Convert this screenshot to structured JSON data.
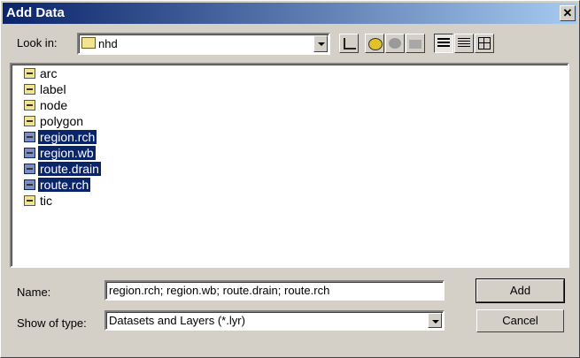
{
  "window": {
    "title": "Add Data",
    "close_label": "✕"
  },
  "lookin": {
    "label": "Look in:",
    "value": "nhd",
    "icon": "folder-icon"
  },
  "toolbar": [
    "up-one-level",
    "connect-to-folder",
    "disconnect-from-folder",
    "new-folder",
    "list-view",
    "details-view",
    "thumbnails-view"
  ],
  "files": [
    {
      "name": "arc",
      "selected": false,
      "icon": "coverage-arc-icon"
    },
    {
      "name": "label",
      "selected": false,
      "icon": "coverage-label-icon"
    },
    {
      "name": "node",
      "selected": false,
      "icon": "coverage-node-icon"
    },
    {
      "name": "polygon",
      "selected": false,
      "icon": "coverage-polygon-icon"
    },
    {
      "name": "region.rch",
      "selected": true,
      "icon": "coverage-region-icon"
    },
    {
      "name": "region.wb",
      "selected": true,
      "icon": "coverage-region-icon"
    },
    {
      "name": "route.drain",
      "selected": true,
      "icon": "coverage-route-icon"
    },
    {
      "name": "route.rch",
      "selected": true,
      "icon": "coverage-route-icon"
    },
    {
      "name": "tic",
      "selected": false,
      "icon": "coverage-tic-icon"
    }
  ],
  "name_field": {
    "label": "Name:",
    "value": "region.rch; region.wb; route.drain; route.rch"
  },
  "type_field": {
    "label": "Show of type:",
    "value": "Datasets and Layers (*.lyr)"
  },
  "buttons": {
    "add": "Add",
    "cancel": "Cancel"
  }
}
